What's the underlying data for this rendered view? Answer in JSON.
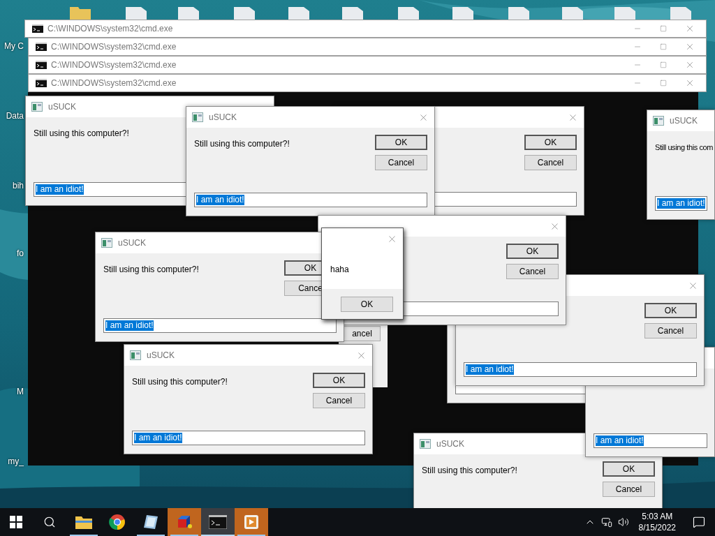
{
  "desktop": {
    "icons": [
      {
        "label": "My C"
      },
      {
        "label": "Data"
      },
      {
        "label": "bih"
      },
      {
        "label": "fo"
      },
      {
        "label": "M"
      },
      {
        "label": "my_"
      }
    ]
  },
  "cmd_windows": [
    {
      "title": "C:\\WINDOWS\\system32\\cmd.exe"
    },
    {
      "title": "C:\\WINDOWS\\system32\\cmd.exe"
    },
    {
      "title": "C:\\WINDOWS\\system32\\cmd.exe"
    },
    {
      "title": "C:\\WINDOWS\\system32\\cmd.exe"
    }
  ],
  "dialogs": [
    {
      "kind": "prompt",
      "title": "uSUCK",
      "message": "Still using this computer?!",
      "input_value": "I am an idiot!",
      "input_selected": true
    },
    {
      "kind": "prompt",
      "buttons": [
        "OK",
        "Cancel"
      ]
    },
    {
      "kind": "prompt",
      "title": "uSUCK",
      "message": "Still using this computer?!",
      "buttons": [
        "OK",
        "Cancel"
      ],
      "input_value": "I am an idiot!",
      "input_selected": true
    },
    {
      "kind": "prompt",
      "title": "uSUCK",
      "message": "Still using this com",
      "input_value": "I am an idiot!",
      "input_selected": true
    },
    {
      "kind": "fragment",
      "buttons": [
        "ancel"
      ]
    },
    {
      "kind": "prompt",
      "title": "uSUCK",
      "message": "Still using this computer?!",
      "buttons": [
        "OK",
        "Cancel"
      ]
    },
    {
      "kind": "prompt"
    },
    {
      "kind": "prompt",
      "input_value": "I am an idiot!",
      "input_selected": true
    },
    {
      "kind": "prompt",
      "buttons": [
        "OK",
        "Cancel"
      ],
      "input_value": "I am an idiot!",
      "input_selected": true
    },
    {
      "kind": "prompt",
      "buttons": [
        "OK",
        "Cancel"
      ]
    },
    {
      "kind": "prompt",
      "title": "uSUCK",
      "message": "Still using this computer?!",
      "buttons": [
        "OK",
        "Cance"
      ],
      "input_value": "I am an idiot!",
      "input_selected": true
    },
    {
      "kind": "prompt",
      "title": "uSUCK",
      "message": "Still using this computer?!",
      "buttons": [
        "OK",
        "Cancel"
      ],
      "input_value": "I am an idiot!",
      "input_selected": true
    },
    {
      "kind": "message",
      "message": "haha",
      "buttons": [
        "OK"
      ]
    }
  ],
  "taskbar": {
    "apps": [
      {
        "open": true,
        "flashing": false,
        "active": false
      },
      {
        "open": false,
        "flashing": false,
        "active": false
      },
      {
        "open": true,
        "flashing": false,
        "active": false
      },
      {
        "open": true,
        "flashing": true,
        "active": false
      },
      {
        "open": true,
        "flashing": false,
        "active": true
      },
      {
        "open": true,
        "flashing": true,
        "active": false
      }
    ],
    "time": "5:03 AM",
    "date": "8/15/2022"
  }
}
